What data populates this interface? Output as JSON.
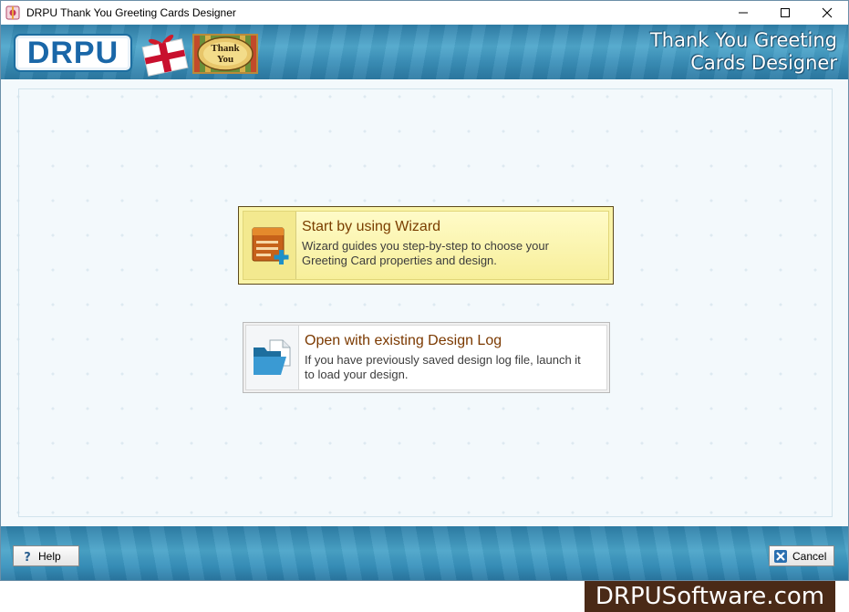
{
  "window": {
    "title": "DRPU Thank You Greeting Cards Designer"
  },
  "header": {
    "logo_text": "DRPU",
    "card_text_1": "Thank",
    "card_text_2": "You",
    "title_line1": "Thank You Greeting",
    "title_line2": "Cards Designer"
  },
  "options": {
    "wizard": {
      "title": "Start by using Wizard",
      "description": "Wizard guides you step-by-step to choose your Greeting Card properties and design.",
      "icon": "wizard-card-add-icon"
    },
    "open": {
      "title": "Open with existing Design Log",
      "description": "If you have previously saved design log file, launch it to load your design.",
      "icon": "open-folder-icon"
    }
  },
  "footer": {
    "help_label": "Help",
    "cancel_label": "Cancel"
  },
  "watermark": {
    "text": "DRPUSoftware.com"
  },
  "colors": {
    "header_blue": "#3a8fb9",
    "wizard_highlight": "#faf4a8",
    "option_title": "#7a3e00",
    "watermark_bg": "#4a2a17"
  }
}
